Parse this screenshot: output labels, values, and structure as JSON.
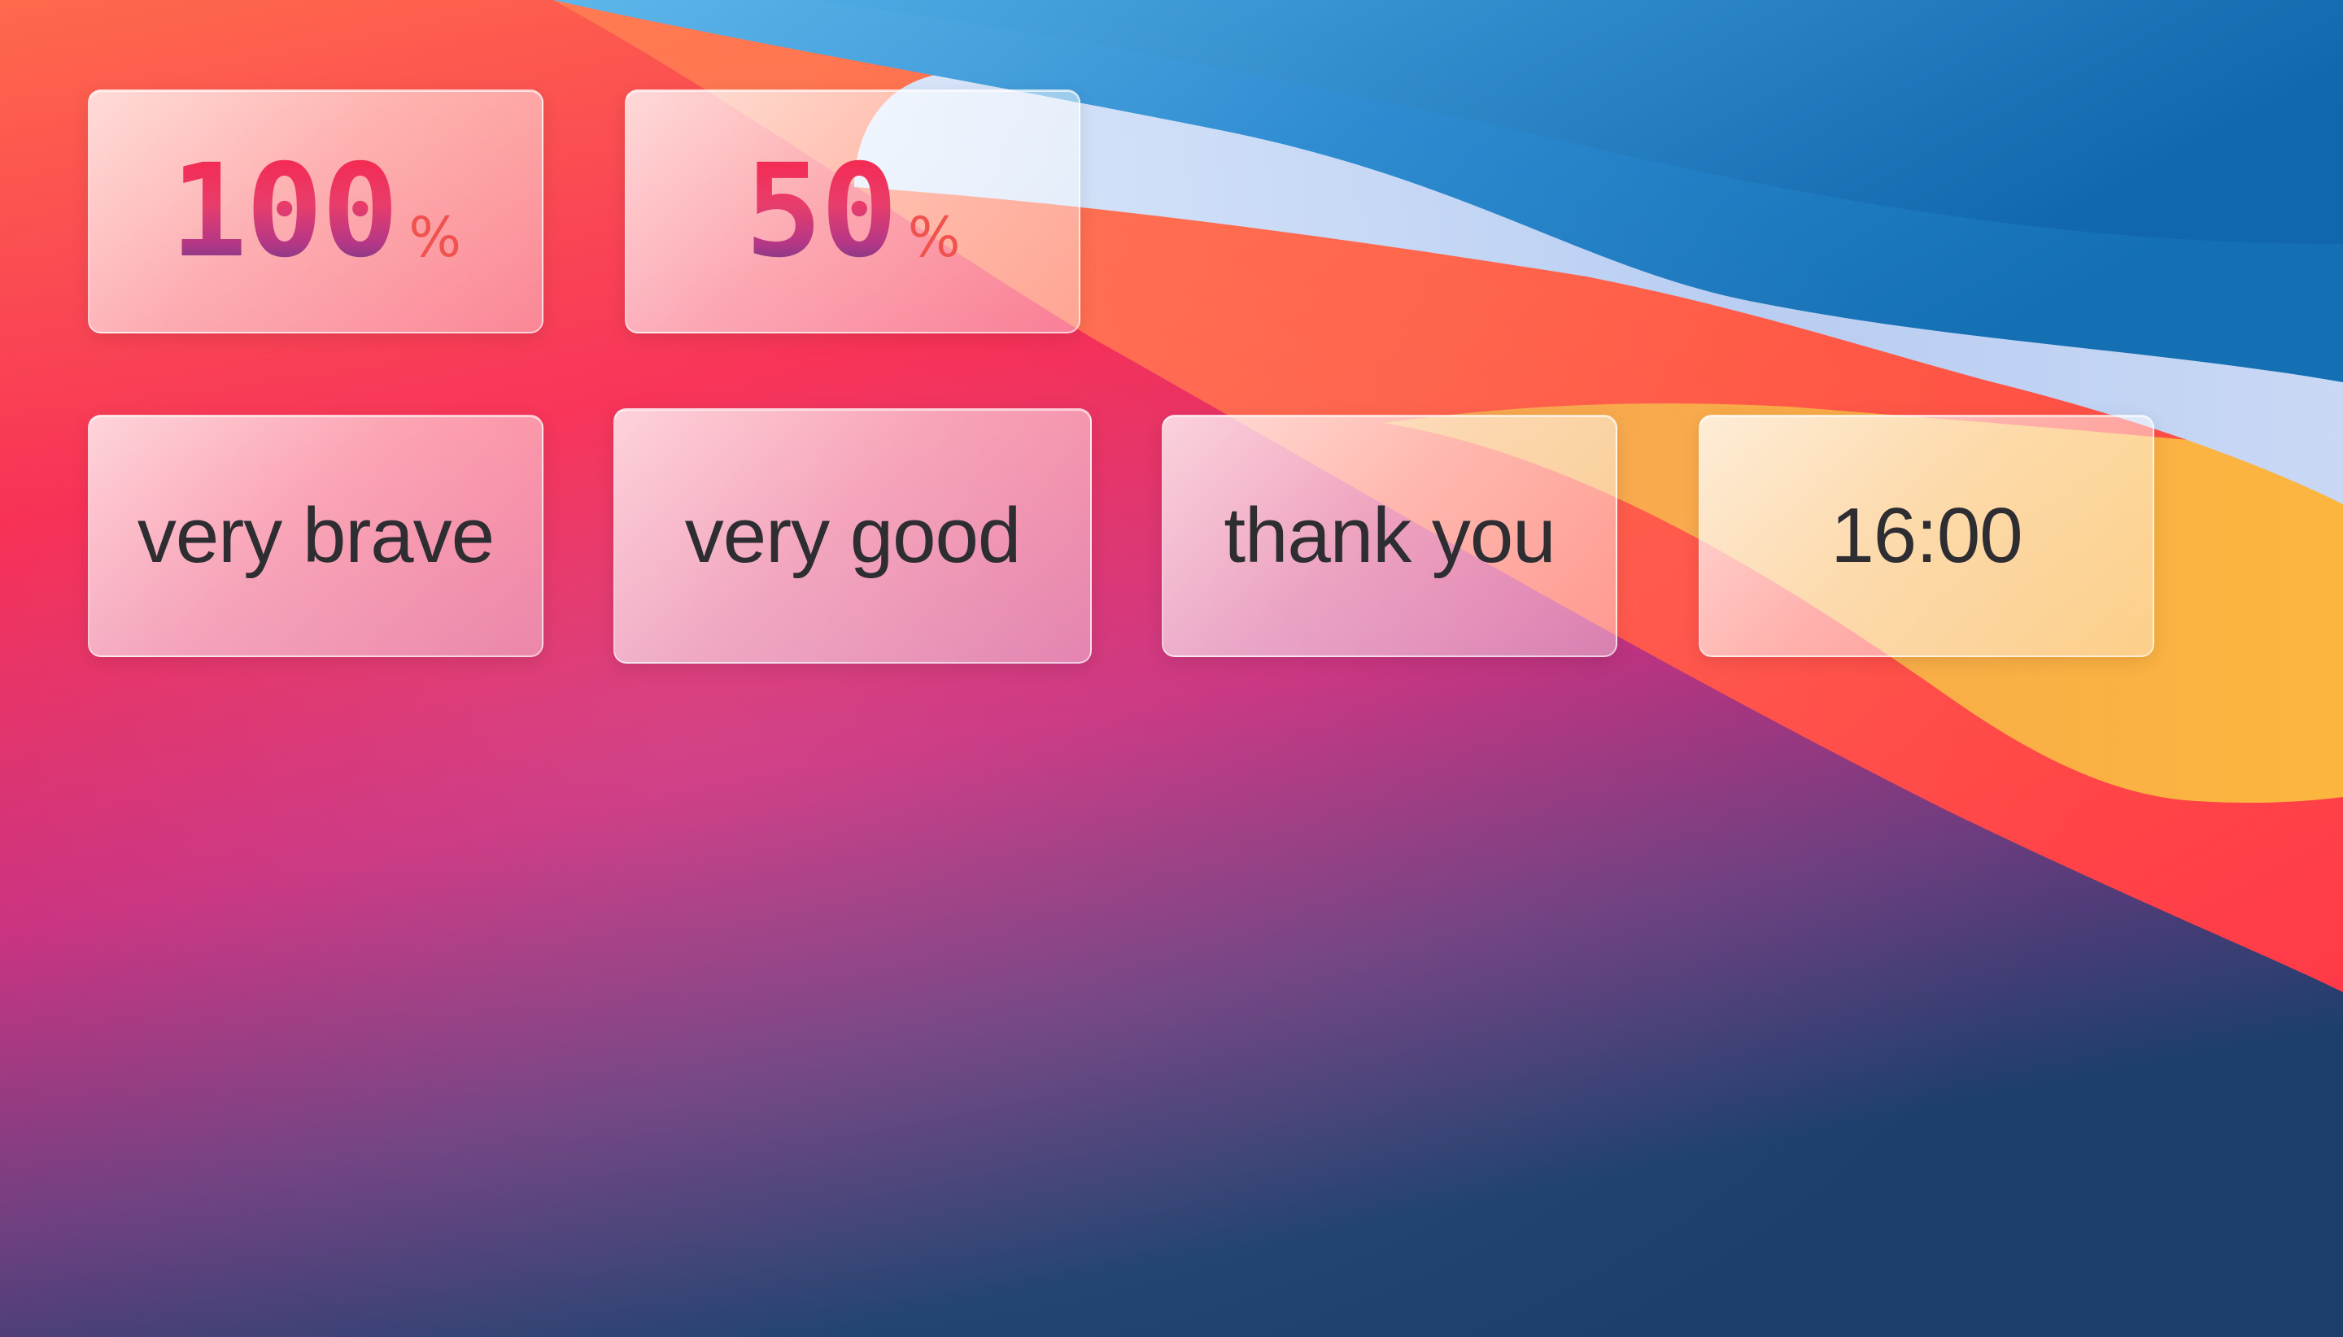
{
  "percent_cards": [
    {
      "value": "100",
      "unit": "%"
    },
    {
      "value": "50",
      "unit": "%"
    }
  ],
  "text_cards": [
    {
      "text": "very brave"
    },
    {
      "text": "very good"
    },
    {
      "text": "thank you"
    },
    {
      "text": "16:00"
    }
  ],
  "colors": {
    "wallpaper_red": "#f7264d",
    "wallpaper_orange": "#ff5a4a",
    "wallpaper_blue": "#1f7fc4",
    "wallpaper_light": "#c7dcf5",
    "wallpaper_yellow": "#fbb040",
    "text_dark": "#2d2d32"
  }
}
